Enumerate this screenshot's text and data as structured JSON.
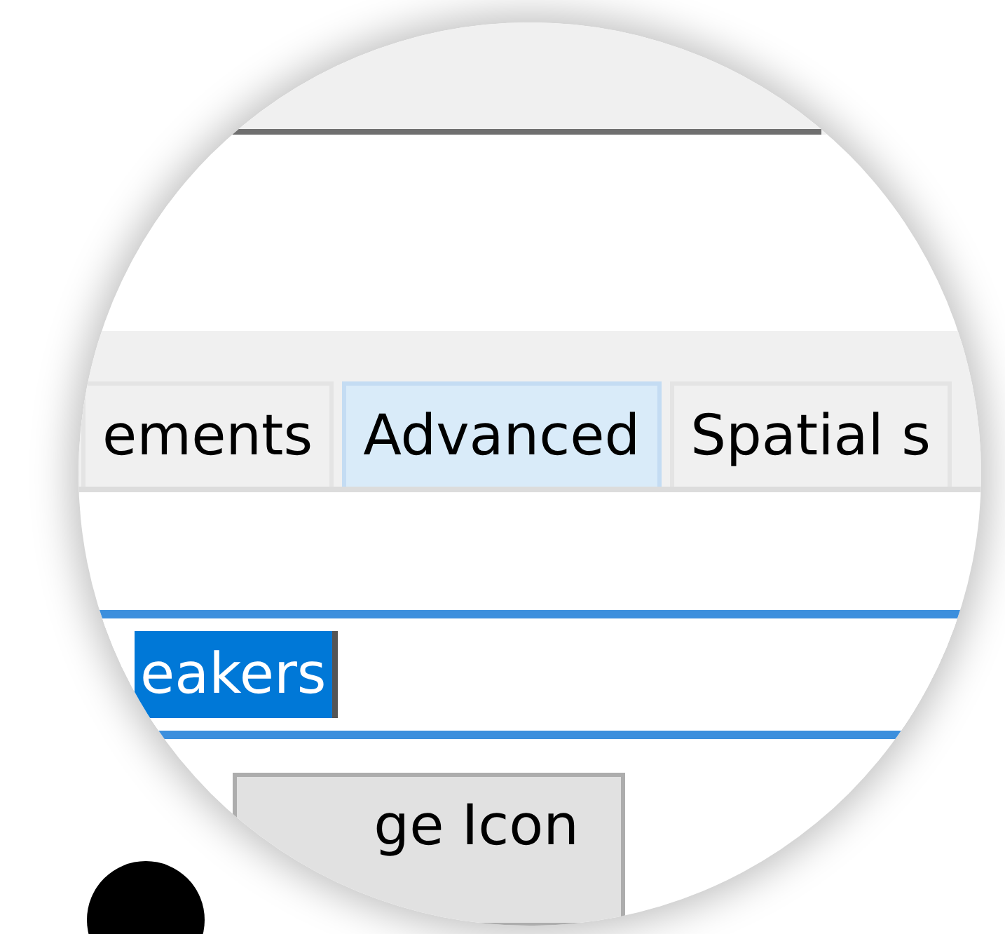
{
  "tabs": [
    {
      "label": "ements",
      "selected": false
    },
    {
      "label": "Advanced",
      "selected": true
    },
    {
      "label": "Spatial s",
      "selected": false
    }
  ],
  "name_field": {
    "value": "eakers",
    "text_selected": true
  },
  "button": {
    "label": "ge Icon"
  }
}
